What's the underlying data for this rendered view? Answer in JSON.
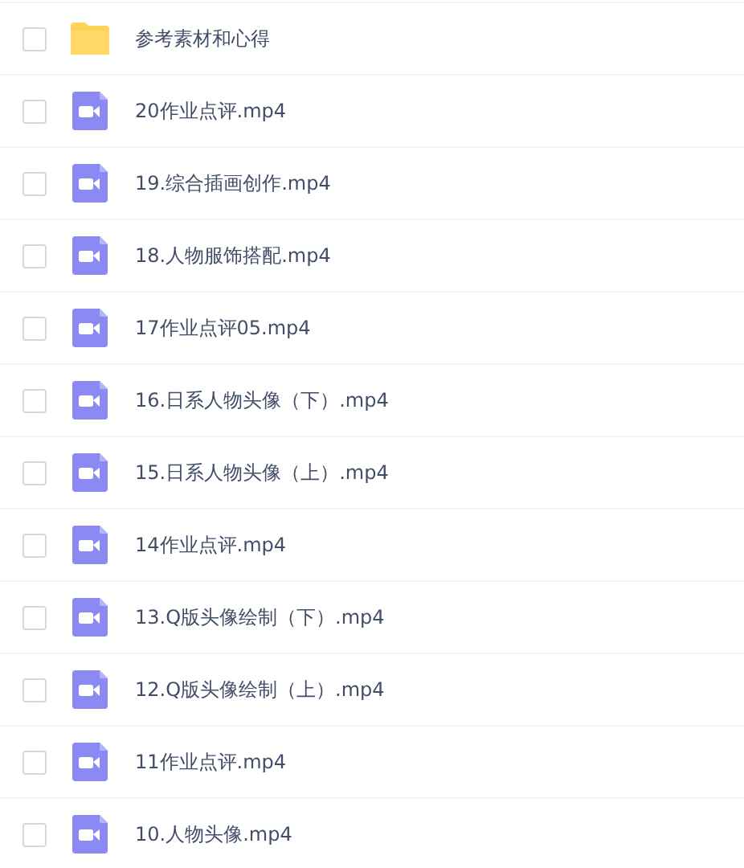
{
  "files": [
    {
      "kind": "folder",
      "name": "参考素材和心得",
      "checked": false
    },
    {
      "kind": "video",
      "name": "20作业点评.mp4",
      "checked": false
    },
    {
      "kind": "video",
      "name": "19.综合插画创作.mp4",
      "checked": false
    },
    {
      "kind": "video",
      "name": "18.人物服饰搭配.mp4",
      "checked": false
    },
    {
      "kind": "video",
      "name": "17作业点评05.mp4",
      "checked": false
    },
    {
      "kind": "video",
      "name": "16.日系人物头像（下）.mp4",
      "checked": false
    },
    {
      "kind": "video",
      "name": "15.日系人物头像（上）.mp4",
      "checked": false
    },
    {
      "kind": "video",
      "name": "14作业点评.mp4",
      "checked": false
    },
    {
      "kind": "video",
      "name": "13.Q版头像绘制（下）.mp4",
      "checked": false
    },
    {
      "kind": "video",
      "name": "12.Q版头像绘制（上）.mp4",
      "checked": false
    },
    {
      "kind": "video",
      "name": "11作业点评.mp4",
      "checked": false
    },
    {
      "kind": "video",
      "name": "10.人物头像.mp4",
      "checked": false
    }
  ]
}
